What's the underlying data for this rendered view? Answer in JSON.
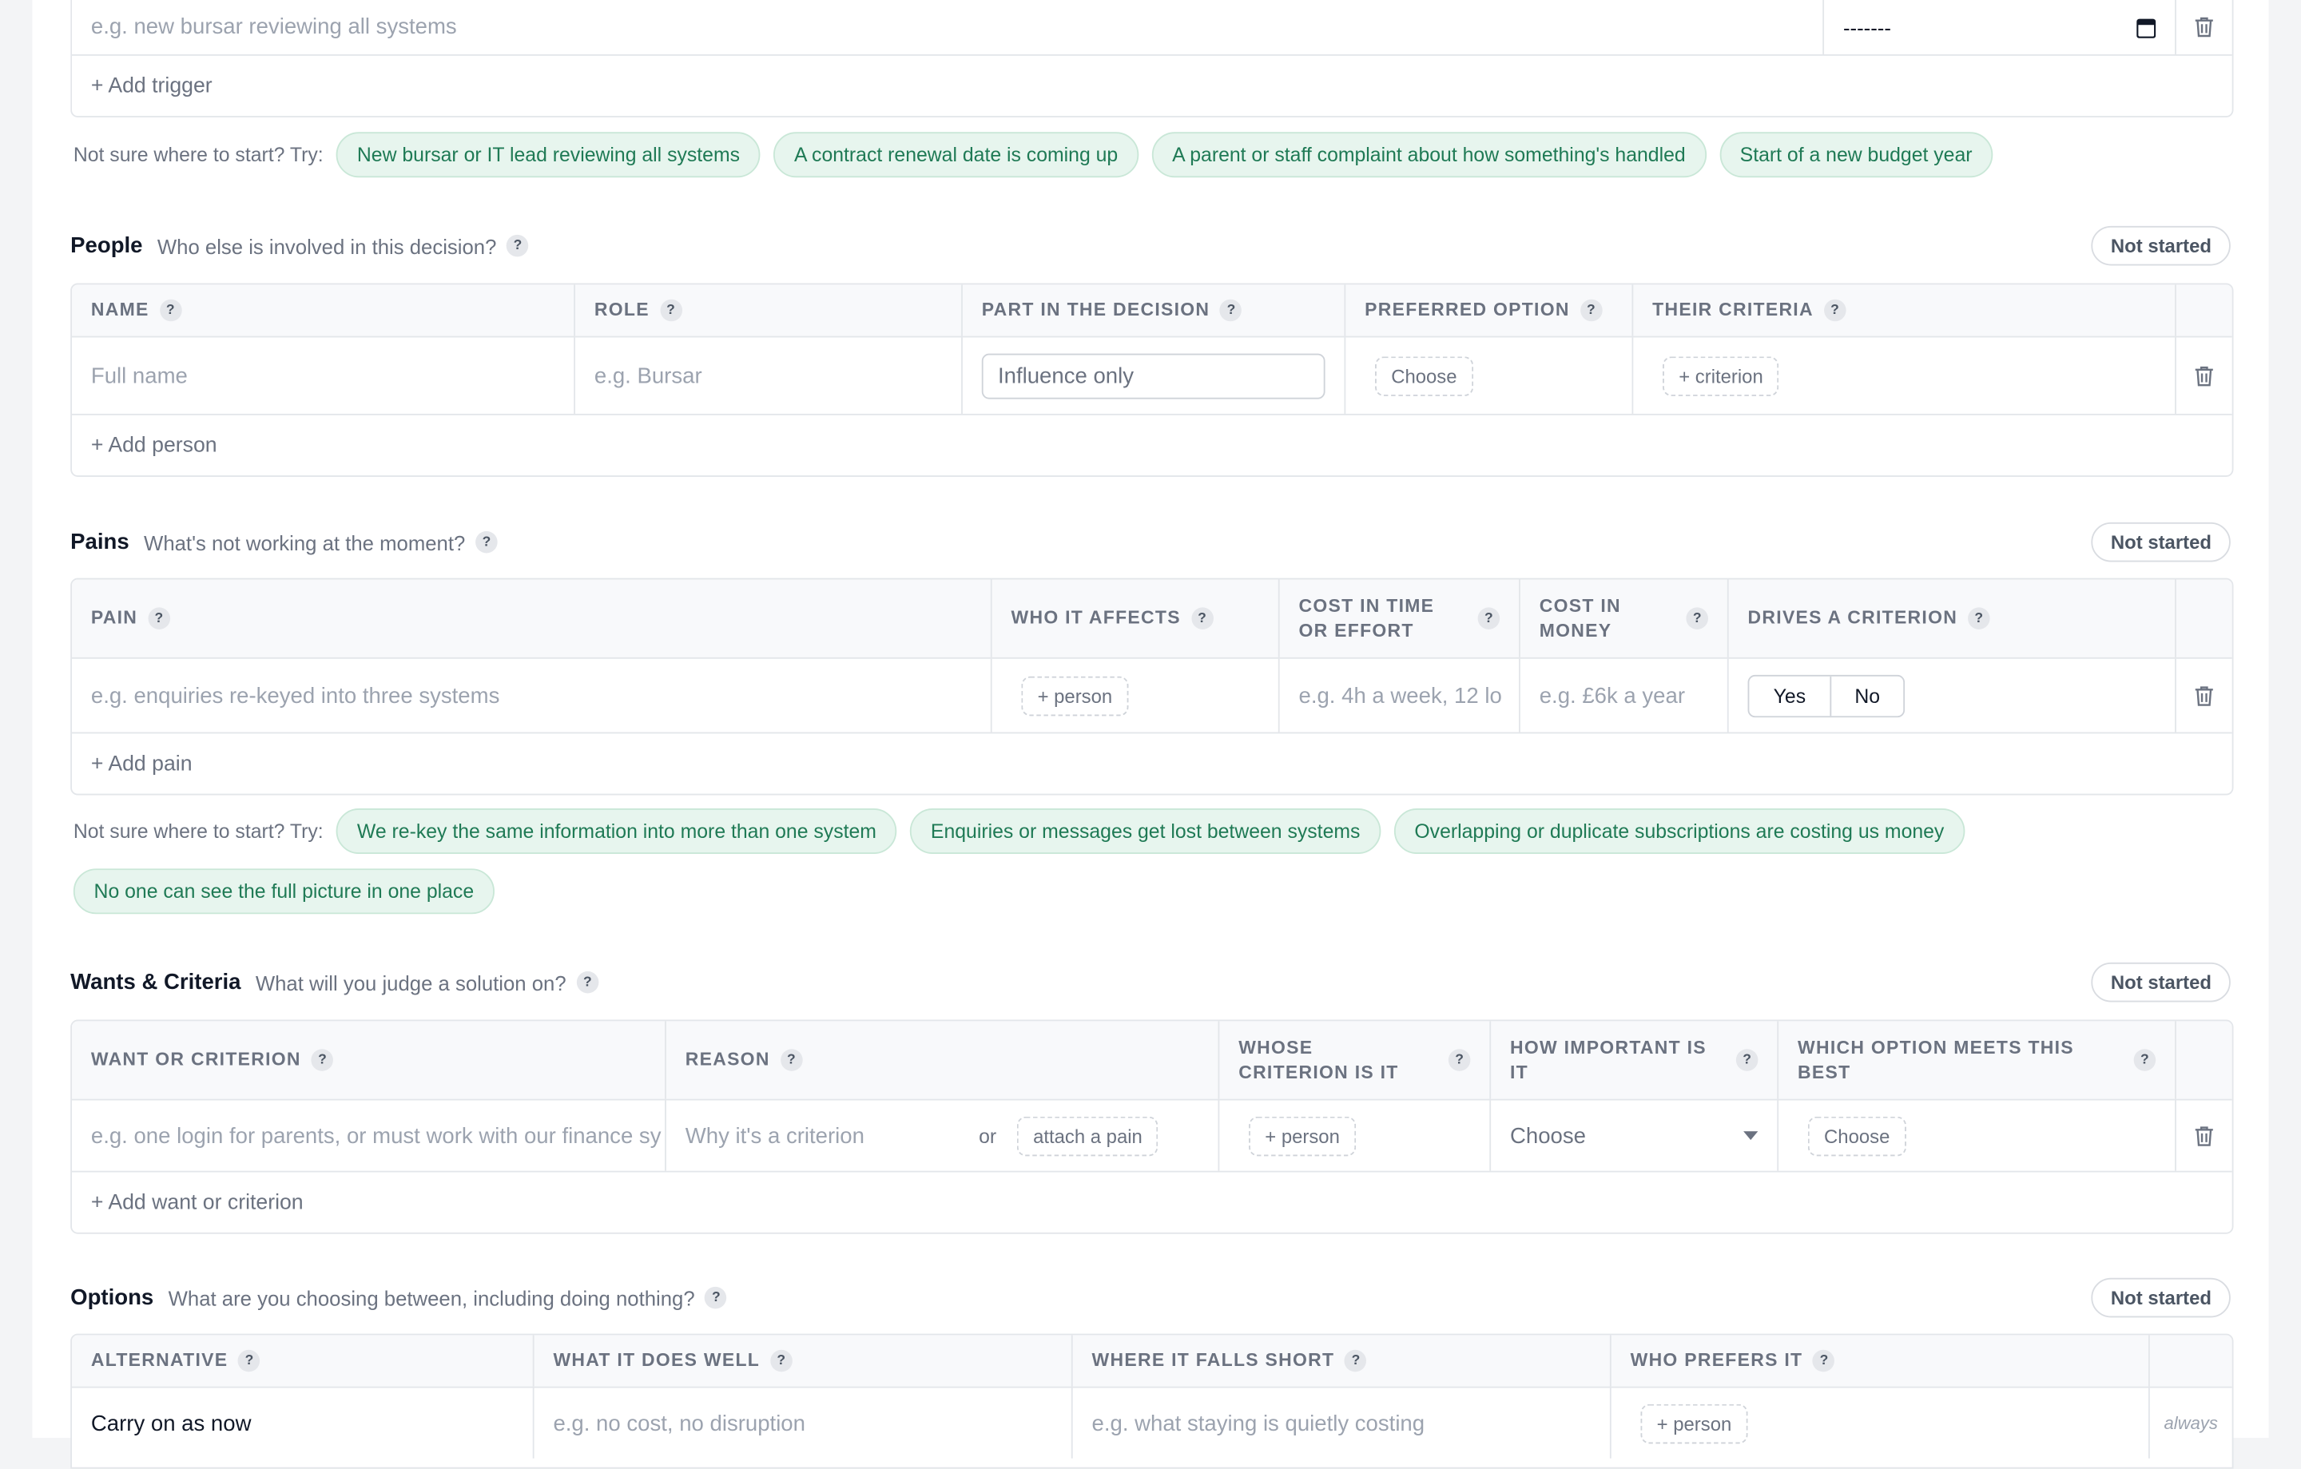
{
  "triggers": {
    "row_placeholder": "e.g. new bursar reviewing all systems",
    "date_value": "-------",
    "add_label": "+ Add trigger",
    "try_label": "Not sure where to start? Try:",
    "chips": [
      "New bursar or IT lead reviewing all systems",
      "A contract renewal date is coming up",
      "A parent or staff complaint about how something's handled",
      "Start of a new budget year"
    ]
  },
  "people": {
    "title": "People",
    "subtitle": "Who else is involved in this decision?",
    "status": "Not started",
    "columns": [
      "Name",
      "Role",
      "Part in the decision",
      "Preferred option",
      "Their criteria"
    ],
    "row": {
      "name_placeholder": "Full name",
      "role_placeholder": "e.g. Bursar",
      "part_value": "Influence only",
      "preferred_button": "Choose",
      "criteria_button": "+ criterion"
    },
    "add_label": "+ Add person"
  },
  "pains": {
    "title": "Pains",
    "subtitle": "What's not working at the moment?",
    "status": "Not started",
    "columns": [
      "Pain",
      "Who it affects",
      "Cost in time or effort",
      "Cost in money",
      "Drives a criterion"
    ],
    "row": {
      "pain_placeholder": "e.g. enquiries re-keyed into three systems",
      "affects_button": "+ person",
      "time_placeholder": "e.g. 4h a week, 12 lo",
      "money_placeholder": "e.g. £6k a year",
      "yes_label": "Yes",
      "no_label": "No"
    },
    "add_label": "+ Add pain",
    "try_label": "Not sure where to start? Try:",
    "chips": [
      "We re-key the same information into more than one system",
      "Enquiries or messages get lost between systems",
      "Overlapping or duplicate subscriptions are costing us money",
      "No one can see the full picture in one place"
    ]
  },
  "wants": {
    "title": "Wants & Criteria",
    "subtitle": "What will you judge a solution on?",
    "status": "Not started",
    "columns": [
      "Want or criterion",
      "Reason",
      "Whose criterion is it",
      "How important is it",
      "Which option meets this best"
    ],
    "row": {
      "want_placeholder": "e.g. one login for parents, or must work with our finance sy",
      "reason_placeholder": "Why it's a criterion",
      "or_label": "or",
      "attach_button": "attach a pain",
      "whose_button": "+ person",
      "importance_value": "Choose",
      "option_button": "Choose"
    },
    "add_label": "+ Add want or criterion"
  },
  "options": {
    "title": "Options",
    "subtitle": "What are you choosing between, including doing nothing?",
    "status": "Not started",
    "columns": [
      "Alternative",
      "What it does well",
      "Where it falls short",
      "Who prefers it"
    ],
    "row": {
      "alternative": "Carry on as now",
      "well_placeholder": "e.g. no cost, no disruption",
      "short_placeholder": "e.g. what staying is quietly costing",
      "prefers_button": "+ person",
      "note": "always"
    }
  },
  "help_glyph": "?",
  "colors": {
    "chip_bg": "#e7f5ee",
    "chip_text": "#1f7a55",
    "border": "#e3e6ea"
  }
}
